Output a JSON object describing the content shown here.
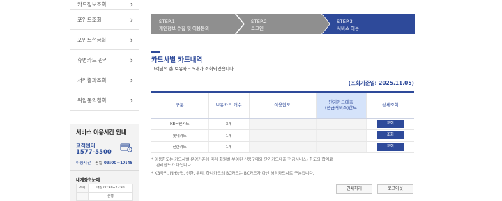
{
  "sidebar": {
    "items": [
      {
        "label": "카드정보조회"
      },
      {
        "label": "포인트조회"
      },
      {
        "label": "포인트현금화"
      },
      {
        "label": "휴면카드 관리"
      },
      {
        "label": "처리결과조회"
      },
      {
        "label": "위임동의철회"
      }
    ],
    "chevron": "›",
    "service_box": {
      "title": "서비스 이용시간 안내",
      "cs_label": "고객센터",
      "cs_phone": "1577-5500",
      "icon": "card-icon",
      "hours_label": "이용시간",
      "hours_days": "평일",
      "hours_time": "09:00~17:45",
      "sub_title": "내계좌한눈에",
      "mini_table": [
        [
          "조회",
          "매일 00:30~23:30"
        ],
        [
          "",
          "은행"
        ]
      ]
    }
  },
  "steps": [
    {
      "no": "STEP.1",
      "name": "개인정보 수집 및 이용동의",
      "active": false
    },
    {
      "no": "STEP.2",
      "name": "로그인",
      "active": false
    },
    {
      "no": "STEP.3",
      "name": "서비스 이용",
      "active": true
    }
  ],
  "content": {
    "title": "카드사별 카드내역",
    "description": "고객님의 총 보유카드 5개가 조회되었습니다.",
    "reference_date": "(조회기준일: 2025.11.05)",
    "table": {
      "headers": [
        "구분",
        "보유카드 개수",
        "이용한도",
        "단기카드대출\n(현금서비스)한도",
        "상세조회"
      ],
      "rows": [
        {
          "company": "KB국민카드",
          "count": "3개",
          "button": "조회"
        },
        {
          "company": "롯데카드",
          "count": "1개",
          "button": "조회"
        },
        {
          "company": "신한카드",
          "count": "1개",
          "button": "조회"
        }
      ]
    },
    "notes": {
      "line1": "* 이용한도는 카드사별 운영기준에 따라 회원별 부여된 신용구매와 단기카드대출(현금서비스) 한도의 합계로",
      "line1_cont": "관리한도가 아닙니다.",
      "line2": "* KB국민, NH농협, 신한, 우리, 하나카드의 BC카드는 BC카드가 아닌 해당카드사로 구분됩니다."
    },
    "buttons": {
      "print": "인쇄하기",
      "logout": "로그아웃"
    }
  },
  "colors": {
    "primary": "#2e4a9a",
    "step_inactive": "#8f8f8f",
    "header_highlight": "#d5e3fa"
  }
}
